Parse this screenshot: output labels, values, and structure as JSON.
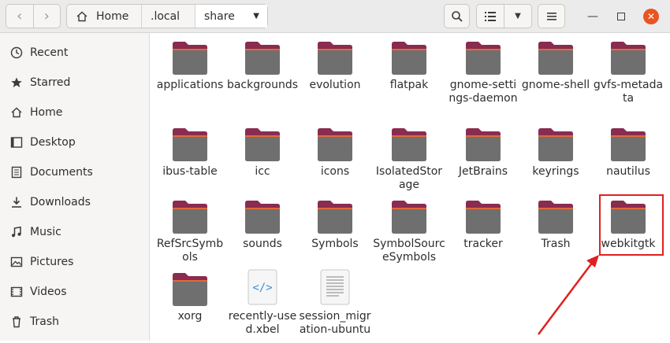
{
  "header": {
    "breadcrumb": [
      "Home",
      ".local",
      "share"
    ],
    "icons": {
      "back": "chevron-left-icon",
      "forward": "chevron-right-icon",
      "home": "home-icon",
      "search": "search-icon",
      "view": "list-view-icon",
      "menu": "hamburger-menu-icon"
    }
  },
  "sidebar": {
    "items": [
      {
        "label": "Recent",
        "icon": "clock-icon"
      },
      {
        "label": "Starred",
        "icon": "star-icon"
      },
      {
        "label": "Home",
        "icon": "home-icon"
      },
      {
        "label": "Desktop",
        "icon": "desktop-icon"
      },
      {
        "label": "Documents",
        "icon": "documents-icon"
      },
      {
        "label": "Downloads",
        "icon": "download-icon"
      },
      {
        "label": "Music",
        "icon": "music-icon"
      },
      {
        "label": "Pictures",
        "icon": "pictures-icon"
      },
      {
        "label": "Videos",
        "icon": "videos-icon"
      },
      {
        "label": "Trash",
        "icon": "trash-icon"
      }
    ]
  },
  "files": [
    {
      "name": "applications",
      "type": "folder"
    },
    {
      "name": "backgrounds",
      "type": "folder"
    },
    {
      "name": "evolution",
      "type": "folder"
    },
    {
      "name": "flatpak",
      "type": "folder"
    },
    {
      "name": "gnome-settings-daemon",
      "type": "folder"
    },
    {
      "name": "gnome-shell",
      "type": "folder"
    },
    {
      "name": "gvfs-metadata",
      "type": "folder"
    },
    {
      "name": "ibus-table",
      "type": "folder"
    },
    {
      "name": "icc",
      "type": "folder"
    },
    {
      "name": "icons",
      "type": "folder"
    },
    {
      "name": "IsolatedStorage",
      "type": "folder"
    },
    {
      "name": "JetBrains",
      "type": "folder"
    },
    {
      "name": "keyrings",
      "type": "folder"
    },
    {
      "name": "nautilus",
      "type": "folder"
    },
    {
      "name": "RefSrcSymbols",
      "type": "folder"
    },
    {
      "name": "sounds",
      "type": "folder"
    },
    {
      "name": "Symbols",
      "type": "folder"
    },
    {
      "name": "SymbolSourceSymbols",
      "type": "folder"
    },
    {
      "name": "tracker",
      "type": "folder"
    },
    {
      "name": "Trash",
      "type": "folder"
    },
    {
      "name": "webkitgtk",
      "type": "folder"
    },
    {
      "name": "xorg",
      "type": "folder"
    },
    {
      "name": "recently-used.xbel",
      "type": "xml"
    },
    {
      "name": "session_migration-ubuntu",
      "type": "text"
    }
  ],
  "colors": {
    "accent": "#e95420",
    "folder_tab": "#8a2b50",
    "folder_body": "#6f6f6f",
    "highlight": "#e02020"
  }
}
